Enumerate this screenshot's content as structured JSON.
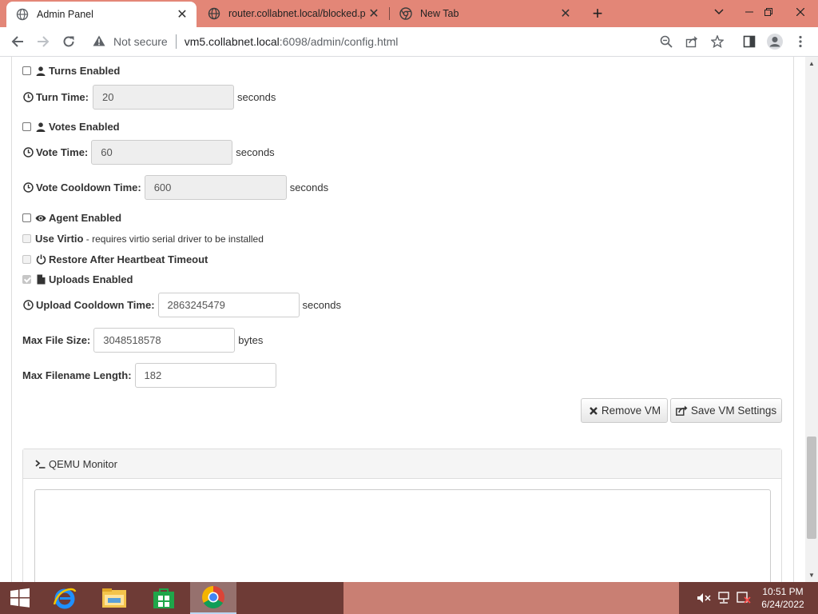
{
  "browser": {
    "tabs": [
      {
        "label": "Admin Panel",
        "icon": "globe-icon",
        "active": true
      },
      {
        "label": "router.collabnet.local/blocked.ph",
        "icon": "globe-icon",
        "active": false
      },
      {
        "label": "New Tab",
        "icon": "chrome-icon",
        "active": false
      }
    ],
    "address": {
      "security_label": "Not secure",
      "host": "vm5.collabnet.local",
      "path": ":6098/admin/config.html"
    }
  },
  "form": {
    "turns_enabled_label": "Turns Enabled",
    "turn_time_label": "Turn Time:",
    "turn_time_value": "20",
    "seconds": "seconds",
    "votes_enabled_label": "Votes Enabled",
    "vote_time_label": "Vote Time:",
    "vote_time_value": "60",
    "vote_cooldown_label": "Vote Cooldown Time:",
    "vote_cooldown_value": "600",
    "agent_enabled_label": "Agent Enabled",
    "use_virtio_label": "Use Virtio",
    "use_virtio_note": " - requires virtio serial driver to be installed",
    "restore_label": "Restore After Heartbeat Timeout",
    "uploads_enabled_label": "Uploads Enabled",
    "upload_cooldown_label": "Upload Cooldown Time:",
    "upload_cooldown_value": "2863245479",
    "max_file_size_label": "Max File Size:",
    "max_file_size_value": "3048518578",
    "bytes": "bytes",
    "max_filename_label": "Max Filename Length:",
    "max_filename_value": "182",
    "remove_vm_label": "Remove VM",
    "save_vm_label": "Save VM Settings"
  },
  "qemu": {
    "title": "QEMU Monitor"
  },
  "taskbar": {
    "time": "10:51 PM",
    "date": "6/24/2022"
  }
}
